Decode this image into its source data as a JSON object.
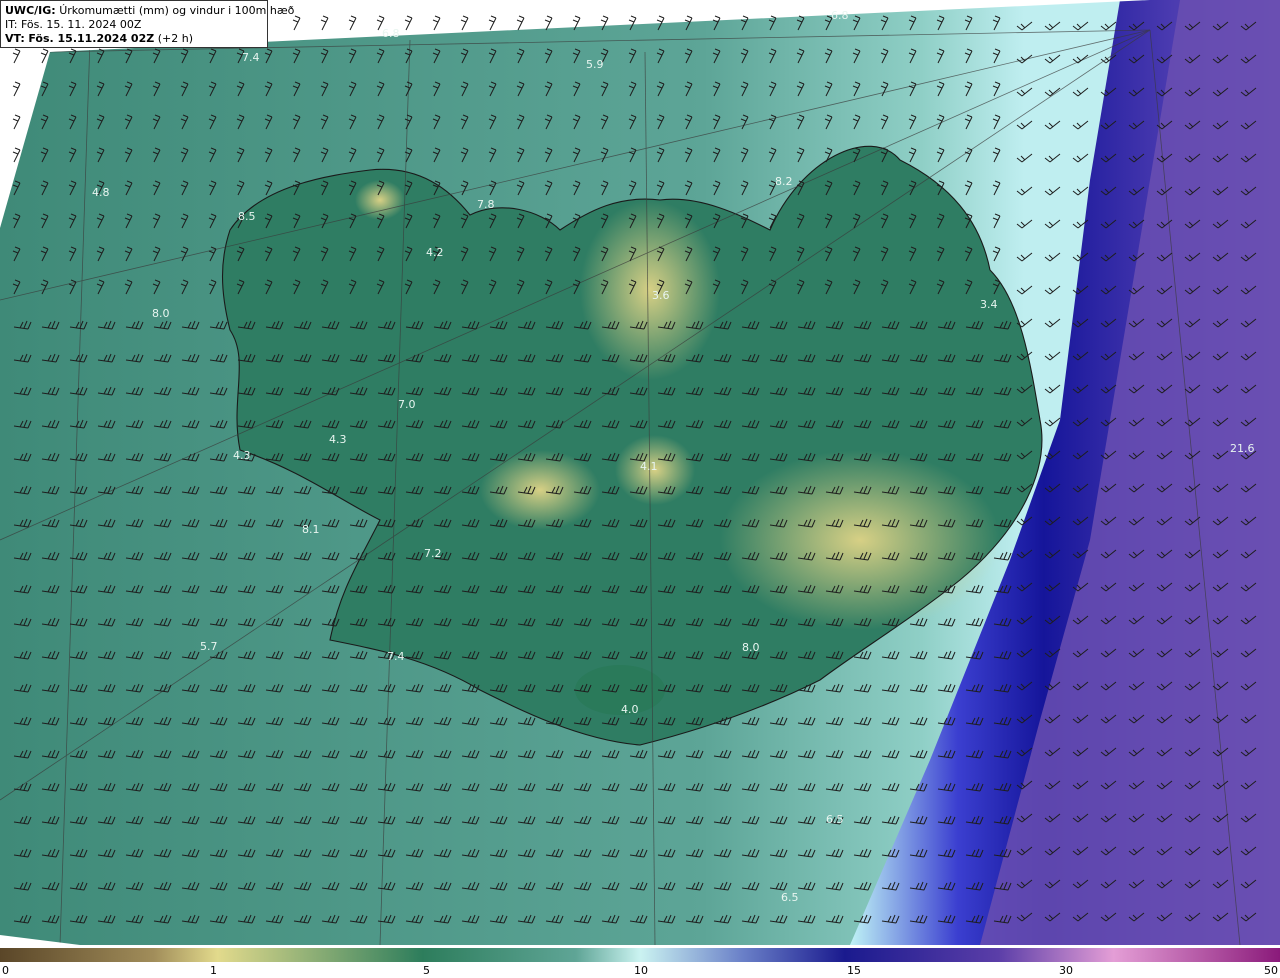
{
  "header": {
    "product": "UWC/IG:",
    "title": "Úrkomumætti (mm) og vindur i 100m hæð",
    "it_label": "IT:",
    "it_value": "Fös. 15. 11. 2024 00Z",
    "vt_label": "VT:",
    "vt_value": "Fös. 15.11.2024 02Z",
    "lead": "(+2 h)"
  },
  "value_labels": [
    {
      "text": "6.8",
      "cls": "top"
    },
    {
      "text": "6.8",
      "cls": "top2"
    },
    {
      "text": "7.4",
      "cls": "a"
    },
    {
      "text": "5.9",
      "cls": "b"
    },
    {
      "text": "4.8",
      "cls": "c"
    },
    {
      "text": "8.5",
      "cls": "d"
    },
    {
      "text": "7.8",
      "cls": "e"
    },
    {
      "text": "8.2",
      "cls": "f"
    },
    {
      "text": "4.2",
      "cls": "g"
    },
    {
      "text": "8.0",
      "cls": "h"
    },
    {
      "text": "3.6",
      "cls": "i"
    },
    {
      "text": "3.4",
      "cls": "j"
    },
    {
      "text": "7.0",
      "cls": "k"
    },
    {
      "text": "4.3",
      "cls": "l"
    },
    {
      "text": "4.3",
      "cls": "m"
    },
    {
      "text": "4.1",
      "cls": "n"
    },
    {
      "text": "21.6",
      "cls": "o"
    },
    {
      "text": "8.1",
      "cls": "p"
    },
    {
      "text": "7.2",
      "cls": "q"
    },
    {
      "text": "5.7",
      "cls": "r"
    },
    {
      "text": "7.4",
      "cls": "s"
    },
    {
      "text": "8.0",
      "cls": "t"
    },
    {
      "text": "4.0",
      "cls": "u"
    },
    {
      "text": "6.5",
      "cls": "v"
    },
    {
      "text": "6.5",
      "cls": "w"
    }
  ],
  "colorbar": {
    "ticks": [
      "0",
      "1",
      "5",
      "10",
      "15",
      "30",
      "50"
    ]
  },
  "colors": {
    "land_low": "#2e7d64",
    "land_high": "#c9c97a",
    "sea": "#4f9a8a",
    "heavy": "#1c1c8c",
    "extreme": "#7a55b8"
  }
}
